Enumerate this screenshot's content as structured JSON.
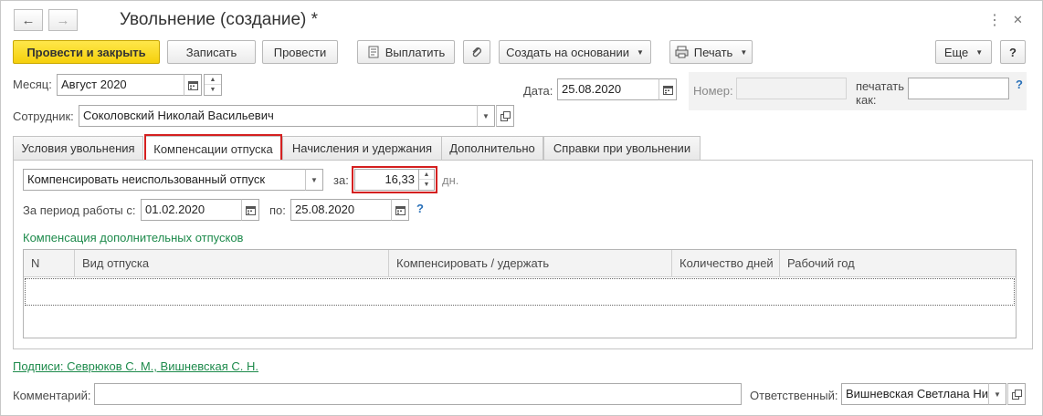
{
  "window": {
    "title": "Увольнение (создание) *",
    "back_icon": "←",
    "forward_icon": "→",
    "menu_icon": "⋮",
    "close_icon": "✕"
  },
  "toolbar": {
    "post_close": "Провести и закрыть",
    "save": "Записать",
    "post": "Провести",
    "pay": "Выплатить",
    "create_based": "Создать на основании",
    "print": "Печать",
    "more": "Еще",
    "help": "?"
  },
  "header": {
    "month_label": "Месяц:",
    "month_value": "Август 2020",
    "date_label": "Дата:",
    "date_value": "25.08.2020",
    "number_label": "Номер:",
    "number_value": "",
    "print_as_label_1": "печатать",
    "print_as_label_2": "как:",
    "print_as_value": "",
    "help": "?",
    "employee_label": "Сотрудник:",
    "employee_value": "Соколовский Николай Васильевич"
  },
  "tabs": [
    {
      "label": "Условия увольнения"
    },
    {
      "label": "Компенсации отпуска"
    },
    {
      "label": "Начисления и удержания"
    },
    {
      "label": "Дополнительно"
    },
    {
      "label": "Справки при увольнении"
    }
  ],
  "compensation": {
    "mode_value": "Компенсировать неиспользованный отпуск",
    "for_label": "за:",
    "days_value": "16,33",
    "days_unit": "дн.",
    "period_label": "За период работы с:",
    "period_from": "01.02.2020",
    "to_label": "по:",
    "period_to": "25.08.2020",
    "help": "?",
    "additional_title": "Компенсация дополнительных отпусков"
  },
  "table": {
    "columns": [
      "N",
      "Вид отпуска",
      "Компенсировать / удержать",
      "Количество дней",
      "Рабочий год"
    ],
    "rows": []
  },
  "footer": {
    "signatures_link": "Подписи: Севрюков С. М., Вишневская С. Н.",
    "comment_label": "Комментарий:",
    "comment_value": "",
    "responsible_label": "Ответственный:",
    "responsible_value": "Вишневская Светлана Ни"
  },
  "colors": {
    "accent_yellow": "#f5d00c",
    "highlight_red": "#d42020",
    "link_green": "#1d8a4b",
    "help_blue": "#2970b8"
  }
}
